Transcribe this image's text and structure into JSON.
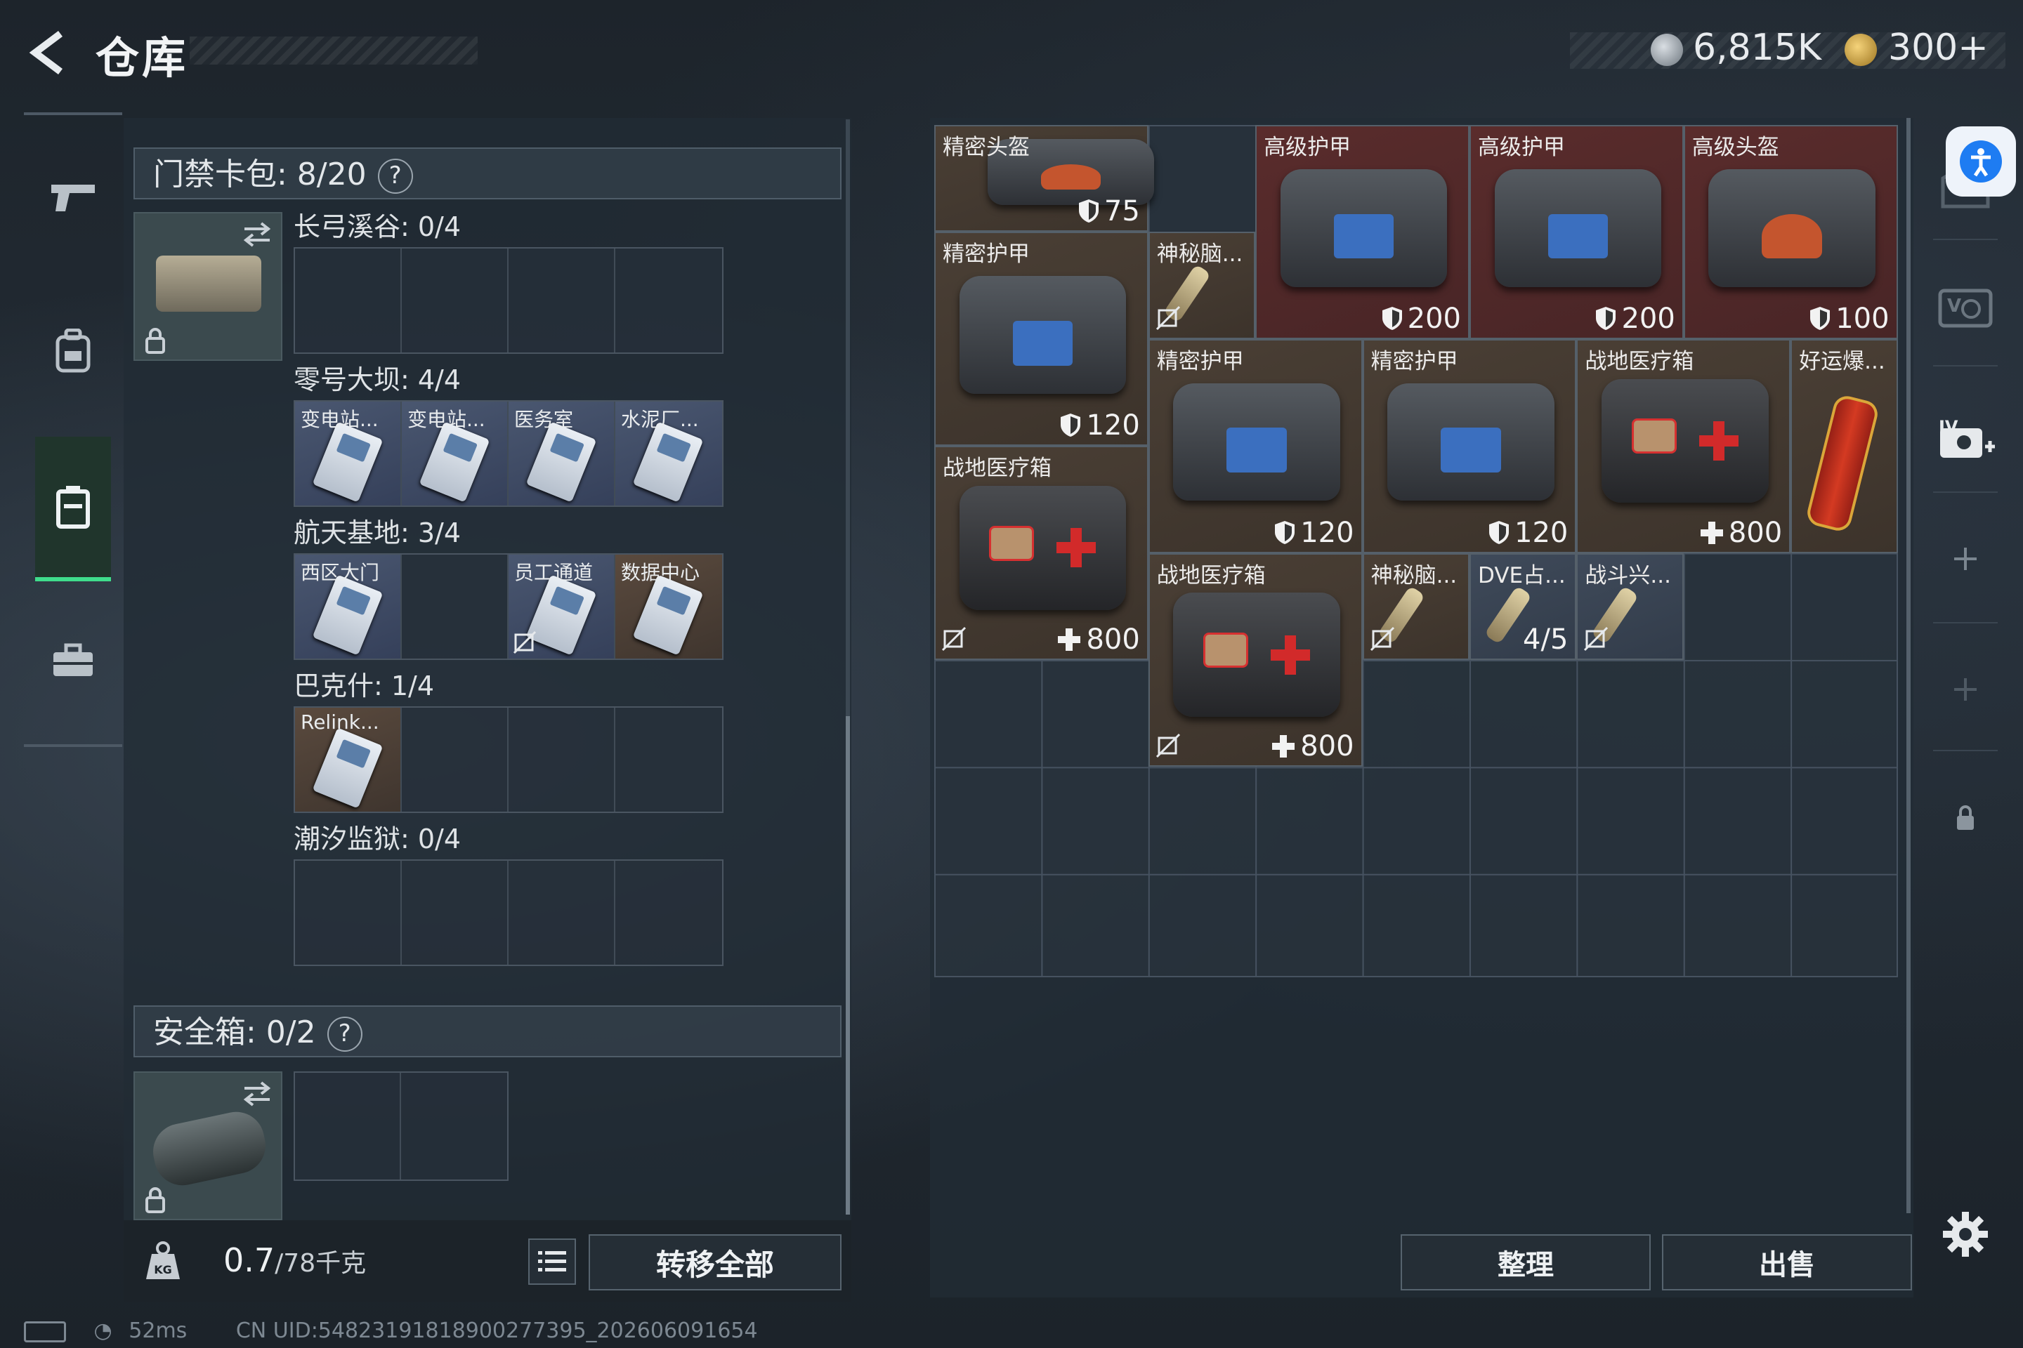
{
  "header": {
    "title": "仓库"
  },
  "currency": {
    "primary_value": "6,815K",
    "secondary_value": "300+"
  },
  "left_nav": {
    "items": [
      "weapon-tab",
      "backpack-tab",
      "case-tab",
      "toolbox-tab"
    ],
    "active": "case-tab"
  },
  "keycard_section": {
    "title": "门禁卡包: 8/20",
    "groups": [
      {
        "label": "长弓溪谷: 0/4",
        "cards": [
          "",
          "",
          "",
          ""
        ]
      },
      {
        "label": "零号大坝: 4/4",
        "cards": [
          "变电站...",
          "变电站...",
          "医务室",
          "水泥厂..."
        ]
      },
      {
        "label": "航天基地: 3/4",
        "cards": [
          "西区大门",
          "",
          "员工通道",
          "数据中心"
        ]
      },
      {
        "label": "巴克什: 1/4",
        "cards": [
          "Relink...",
          "",
          "",
          ""
        ]
      },
      {
        "label": "潮汐监狱: 0/4",
        "cards": [
          "",
          "",
          "",
          ""
        ]
      }
    ]
  },
  "safebox_section": {
    "title": "安全箱: 0/2"
  },
  "weight": {
    "value": "0.7",
    "capacity": "/78千克"
  },
  "buttons": {
    "transfer_all": "转移全部",
    "sort": "整理",
    "sell": "出售"
  },
  "stash_items": [
    {
      "name": "精密头盔",
      "value": "75",
      "kind": "shield"
    },
    {
      "name": "高级护甲",
      "value": "200",
      "kind": "shield"
    },
    {
      "name": "高级护甲",
      "value": "200",
      "kind": "shield"
    },
    {
      "name": "高级头盔",
      "value": "100",
      "kind": "shield"
    },
    {
      "name": "精密护甲",
      "value": "120",
      "kind": "shield"
    },
    {
      "name": "神秘脑...",
      "value": "",
      "kind": "none"
    },
    {
      "name": "精密护甲",
      "value": "120",
      "kind": "shield"
    },
    {
      "name": "精密护甲",
      "value": "120",
      "kind": "shield"
    },
    {
      "name": "战地医疗箱",
      "value": "800",
      "kind": "heal"
    },
    {
      "name": "好运爆...",
      "value": "",
      "kind": "none"
    },
    {
      "name": "战地医疗箱",
      "value": "800",
      "kind": "heal"
    },
    {
      "name": "战地医疗箱",
      "value": "800",
      "kind": "heal"
    },
    {
      "name": "神秘脑...",
      "value": "",
      "kind": "none"
    },
    {
      "name": "DVE占...",
      "value": "4/5",
      "kind": "count"
    },
    {
      "name": "战斗兴...",
      "value": "",
      "kind": "none"
    }
  ],
  "status_bar": {
    "ping": "52ms",
    "uid": "CN UID:5482319181890027739​5_202606091654"
  },
  "colors": {
    "accent_green": "#3fdc8c",
    "access_blue": "#1e7cf2"
  }
}
